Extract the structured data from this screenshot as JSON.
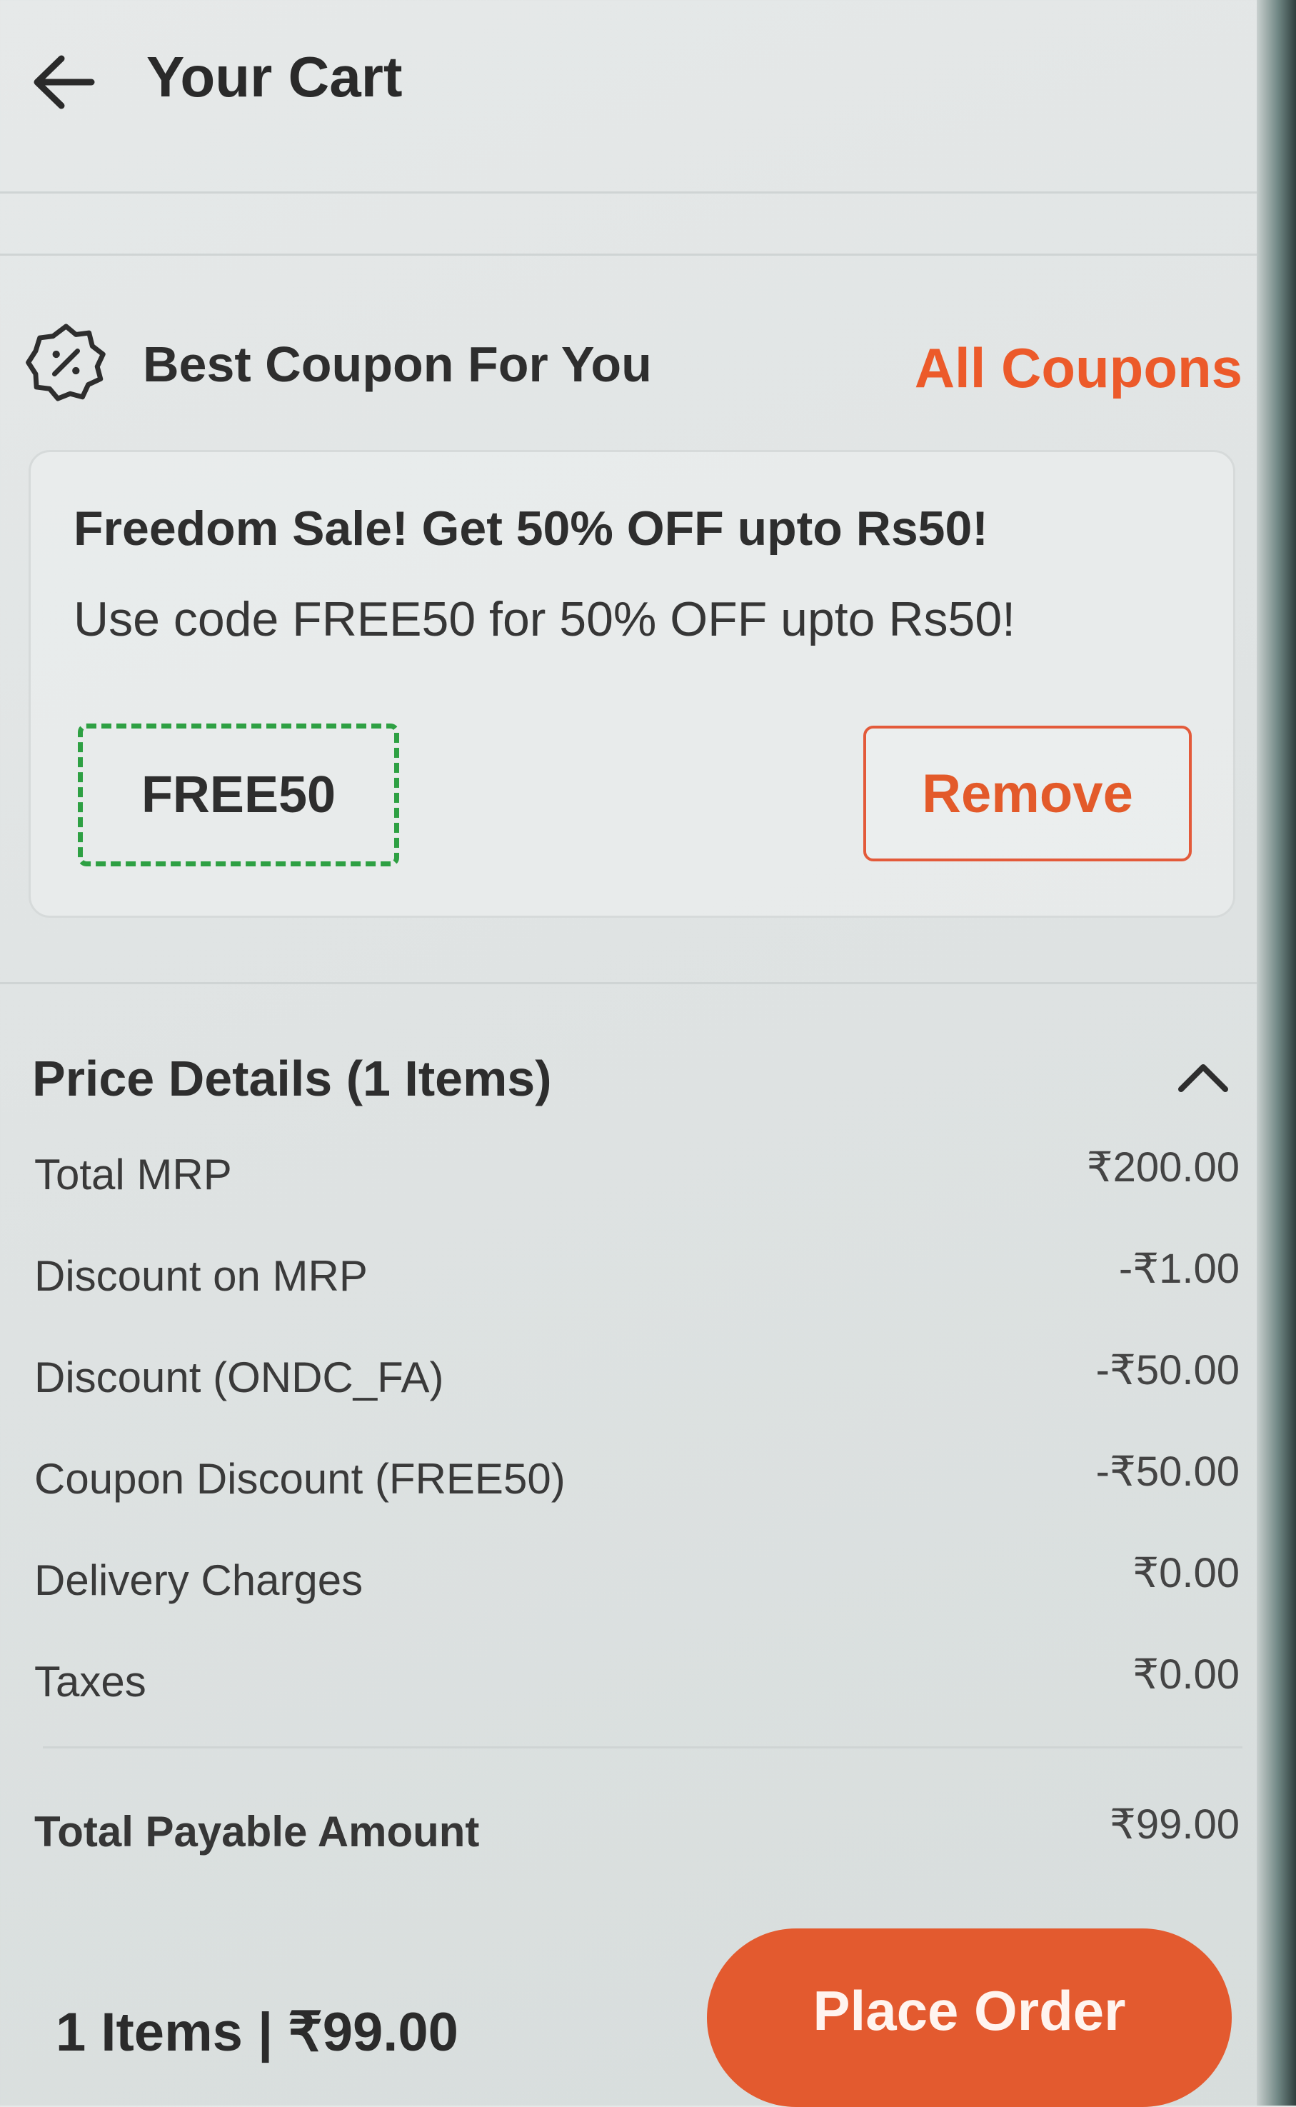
{
  "header": {
    "title": "Your Cart",
    "back_icon": "arrow-left-icon"
  },
  "coupon": {
    "heading": "Best Coupon For You",
    "icon": "discount-badge-icon",
    "all_coupons_label": "All Coupons",
    "title": "Freedom Sale! Get 50% OFF upto Rs50!",
    "description": "Use code FREE50 for 50% OFF upto Rs50!",
    "code": "FREE50",
    "remove_label": "Remove"
  },
  "price_details": {
    "heading": "Price Details (1 Items)",
    "collapse_icon": "chevron-up-icon",
    "rows": [
      {
        "label": "Total MRP",
        "value": "₹200.00"
      },
      {
        "label": "Discount on MRP",
        "value": "-₹1.00"
      },
      {
        "label": "Discount (ONDC_FA)",
        "value": "-₹50.00"
      },
      {
        "label": "Coupon Discount (FREE50)",
        "value": "-₹50.00"
      },
      {
        "label": "Delivery Charges",
        "value": "₹0.00"
      },
      {
        "label": "Taxes",
        "value": "₹0.00"
      }
    ],
    "total_label": "Total Payable Amount",
    "total_value": "₹99.00"
  },
  "footer": {
    "summary": "1 Items | ₹99.00",
    "place_order_label": "Place Order"
  },
  "colors": {
    "accent": "#e35a2f",
    "coupon_code_border": "#2ea043"
  }
}
